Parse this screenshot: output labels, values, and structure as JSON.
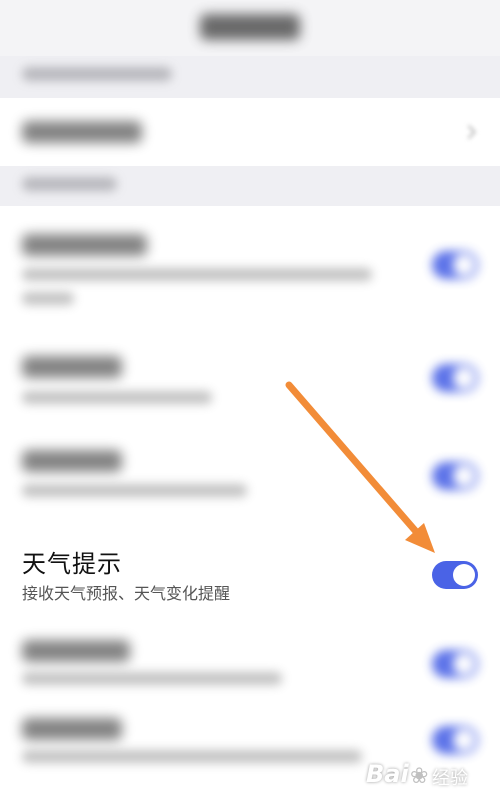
{
  "weather_row": {
    "title": "天气提示",
    "subtitle": "接收天气预报、天气变化提醒",
    "toggle_on": true
  },
  "toggles_on": [
    true,
    true,
    true,
    true,
    true,
    true
  ],
  "accent_color": "#4a63e6",
  "annotation": {
    "arrow_color": "#f28c38"
  },
  "watermark": {
    "logo_text": "Bai",
    "site_text": "经验"
  }
}
